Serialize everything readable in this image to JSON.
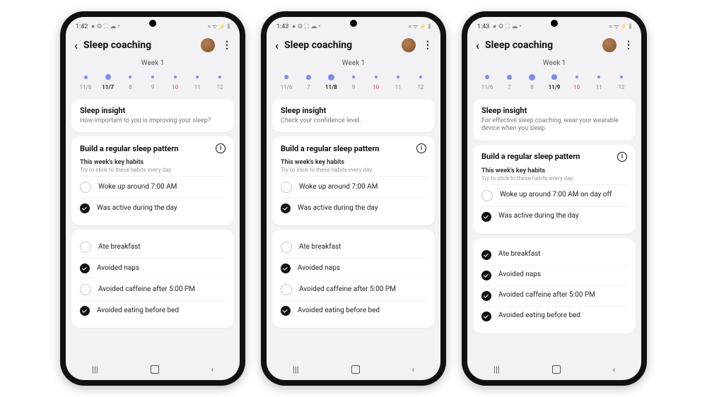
{
  "phones": [
    {
      "time": "1:42",
      "status_left": "● ⚙ ⛶ ☁ •",
      "status_right": "≈ ᯤ ⚡ ⫼",
      "title": "Sleep coaching",
      "week": "Week 1",
      "dots_sizes": [
        5,
        8,
        4,
        4,
        4,
        4,
        4
      ],
      "labels": [
        "11/6",
        "11/7",
        "8",
        "9",
        "10",
        "11",
        "12"
      ],
      "sel_index": 1,
      "weekend_indices": [
        4
      ],
      "insight_title": "Sleep insight",
      "insight_text": "How important to you is improving your sleep?",
      "pattern_title": "Build a regular sleep pattern",
      "habits_hdr": "This week's key habits",
      "habits_sub": "Try to stick to these habits every day.",
      "groups": [
        [
          {
            "done": false,
            "label": "Woke up around 7:00 AM"
          },
          {
            "done": true,
            "label": "Was active during the day"
          }
        ],
        [
          {
            "done": false,
            "label": "Ate breakfast"
          },
          {
            "done": true,
            "label": "Avoided naps"
          },
          {
            "done": false,
            "label": "Avoided caffeine after 5:00 PM"
          },
          {
            "done": true,
            "label": "Avoided eating before bed"
          }
        ]
      ]
    },
    {
      "time": "1:43",
      "status_left": "● ⚙ ⛶ ☁ •",
      "status_right": "≈ ᯤ ⚡ ⫼",
      "title": "Sleep coaching",
      "week": "Week 1",
      "dots_sizes": [
        6,
        7,
        9,
        4,
        4,
        4,
        4
      ],
      "labels": [
        "11/6",
        "7",
        "11/8",
        "9",
        "10",
        "11",
        "12"
      ],
      "sel_index": 2,
      "weekend_indices": [
        4
      ],
      "insight_title": "Sleep insight",
      "insight_text": "Check your confidence level.",
      "pattern_title": "Build a regular sleep pattern",
      "habits_hdr": "This week's key habits",
      "habits_sub": "Try to stick to these habits every day.",
      "groups": [
        [
          {
            "done": false,
            "label": "Woke up around 7:00 AM"
          },
          {
            "done": true,
            "label": "Was active during the day"
          }
        ],
        [
          {
            "done": false,
            "label": "Ate breakfast"
          },
          {
            "done": true,
            "label": "Avoided naps"
          },
          {
            "done": false,
            "label": "Avoided caffeine after 5:00 PM"
          },
          {
            "done": true,
            "label": "Avoided eating before bed"
          }
        ]
      ]
    },
    {
      "time": "1:43",
      "status_left": "● ⚙ ⛶ ☁ •",
      "status_right": "≈ ᯤ ⚡ ⫼",
      "title": "Sleep coaching",
      "week": "Week 1",
      "dots_sizes": [
        6,
        7,
        9,
        8,
        4,
        4,
        4
      ],
      "labels": [
        "11/6",
        "7",
        "8",
        "11/9",
        "10",
        "11",
        "12"
      ],
      "sel_index": 3,
      "weekend_indices": [
        4
      ],
      "insight_title": "Sleep insight",
      "insight_text": "For effective sleep coaching, wear your wearable device when you sleep.",
      "pattern_title": "Build a regular sleep pattern",
      "habits_hdr": "This week's key habits",
      "habits_sub": "Try to stick to these habits every day.",
      "groups": [
        [
          {
            "done": false,
            "label": "Woke up around 7:00 AM on day off"
          },
          {
            "done": true,
            "label": "Was active during the day"
          }
        ],
        [
          {
            "done": true,
            "label": "Ate breakfast"
          },
          {
            "done": true,
            "label": "Avoided naps"
          },
          {
            "done": true,
            "label": "Avoided caffeine after 5:00 PM"
          },
          {
            "done": true,
            "label": "Avoided eating before bed"
          }
        ]
      ]
    }
  ]
}
